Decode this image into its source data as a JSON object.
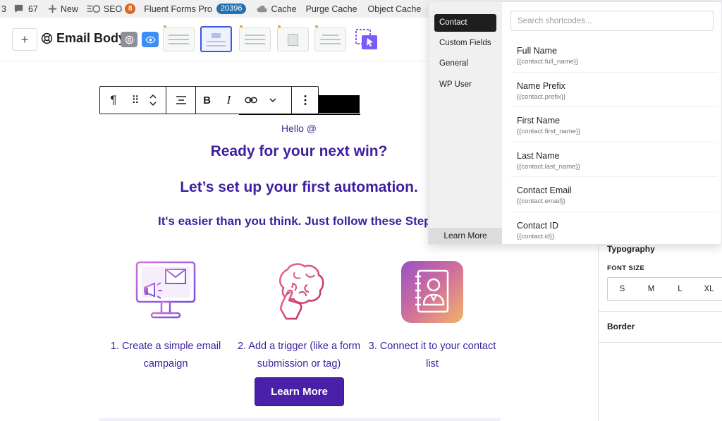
{
  "adminbar": {
    "items": [
      {
        "icon": "count",
        "label": "3"
      },
      {
        "icon": "comment-icon",
        "label": "67"
      },
      {
        "icon": "plus-icon",
        "label": "New"
      },
      {
        "icon": "seo-icon",
        "label": "SEO",
        "badge": "8"
      },
      {
        "icon": "",
        "label": "Fluent Forms Pro",
        "badge": "20396"
      },
      {
        "icon": "cloud-icon",
        "label": "Cache"
      },
      {
        "icon": "",
        "label": "Purge Cache"
      },
      {
        "icon": "",
        "label": "Object Cache"
      }
    ]
  },
  "toolbar": {
    "add_label": "+",
    "title": "Email Body"
  },
  "block_toolbar": {
    "paragraph": "¶",
    "drag": "⠿",
    "align": "≡",
    "bold": "B",
    "italic": "I",
    "link": "⟷",
    "more": "⌄",
    "options": "⋮"
  },
  "email": {
    "hello": "Hello @",
    "heading1": "Ready for your next win?",
    "heading2": "Let’s set up your first automation.",
    "heading3": "It's easier than you think. Just follow these Step",
    "steps": [
      {
        "icon": "monitor-email-icon",
        "text": "1. Create a simple email campaign"
      },
      {
        "icon": "brain-touch-icon",
        "text": "2. Add a trigger (like a form submission or tag)"
      },
      {
        "icon": "contact-book-icon",
        "text": "3. Connect it to your contact list"
      }
    ],
    "button": "Learn More"
  },
  "settings": {
    "typography": "Typography",
    "font_size_label": "FONT SIZE",
    "font_sizes": [
      "S",
      "M",
      "L",
      "XL"
    ],
    "border": "Border"
  },
  "shortcodes": {
    "categories": [
      "Contact",
      "Custom Fields",
      "General",
      "WP User"
    ],
    "active_category": "Contact",
    "learn_more": "Learn More",
    "search_placeholder": "Search shortcodes...",
    "items": [
      {
        "name": "Full Name",
        "code": "{{contact.full_name}}"
      },
      {
        "name": "Name Prefix",
        "code": "{{contact.prefix}}"
      },
      {
        "name": "First Name",
        "code": "{{contact.first_name}}"
      },
      {
        "name": "Last Name",
        "code": "{{contact.last_name}}"
      },
      {
        "name": "Contact Email",
        "code": "{{contact.email}}"
      },
      {
        "name": "Contact ID",
        "code": "{{contact.id}}"
      }
    ]
  },
  "colors": {
    "brand_purple": "#3d1fa0",
    "button_purple": "#4a20a8",
    "accent_blue": "#2271b1",
    "badge_red": "#d63638"
  }
}
